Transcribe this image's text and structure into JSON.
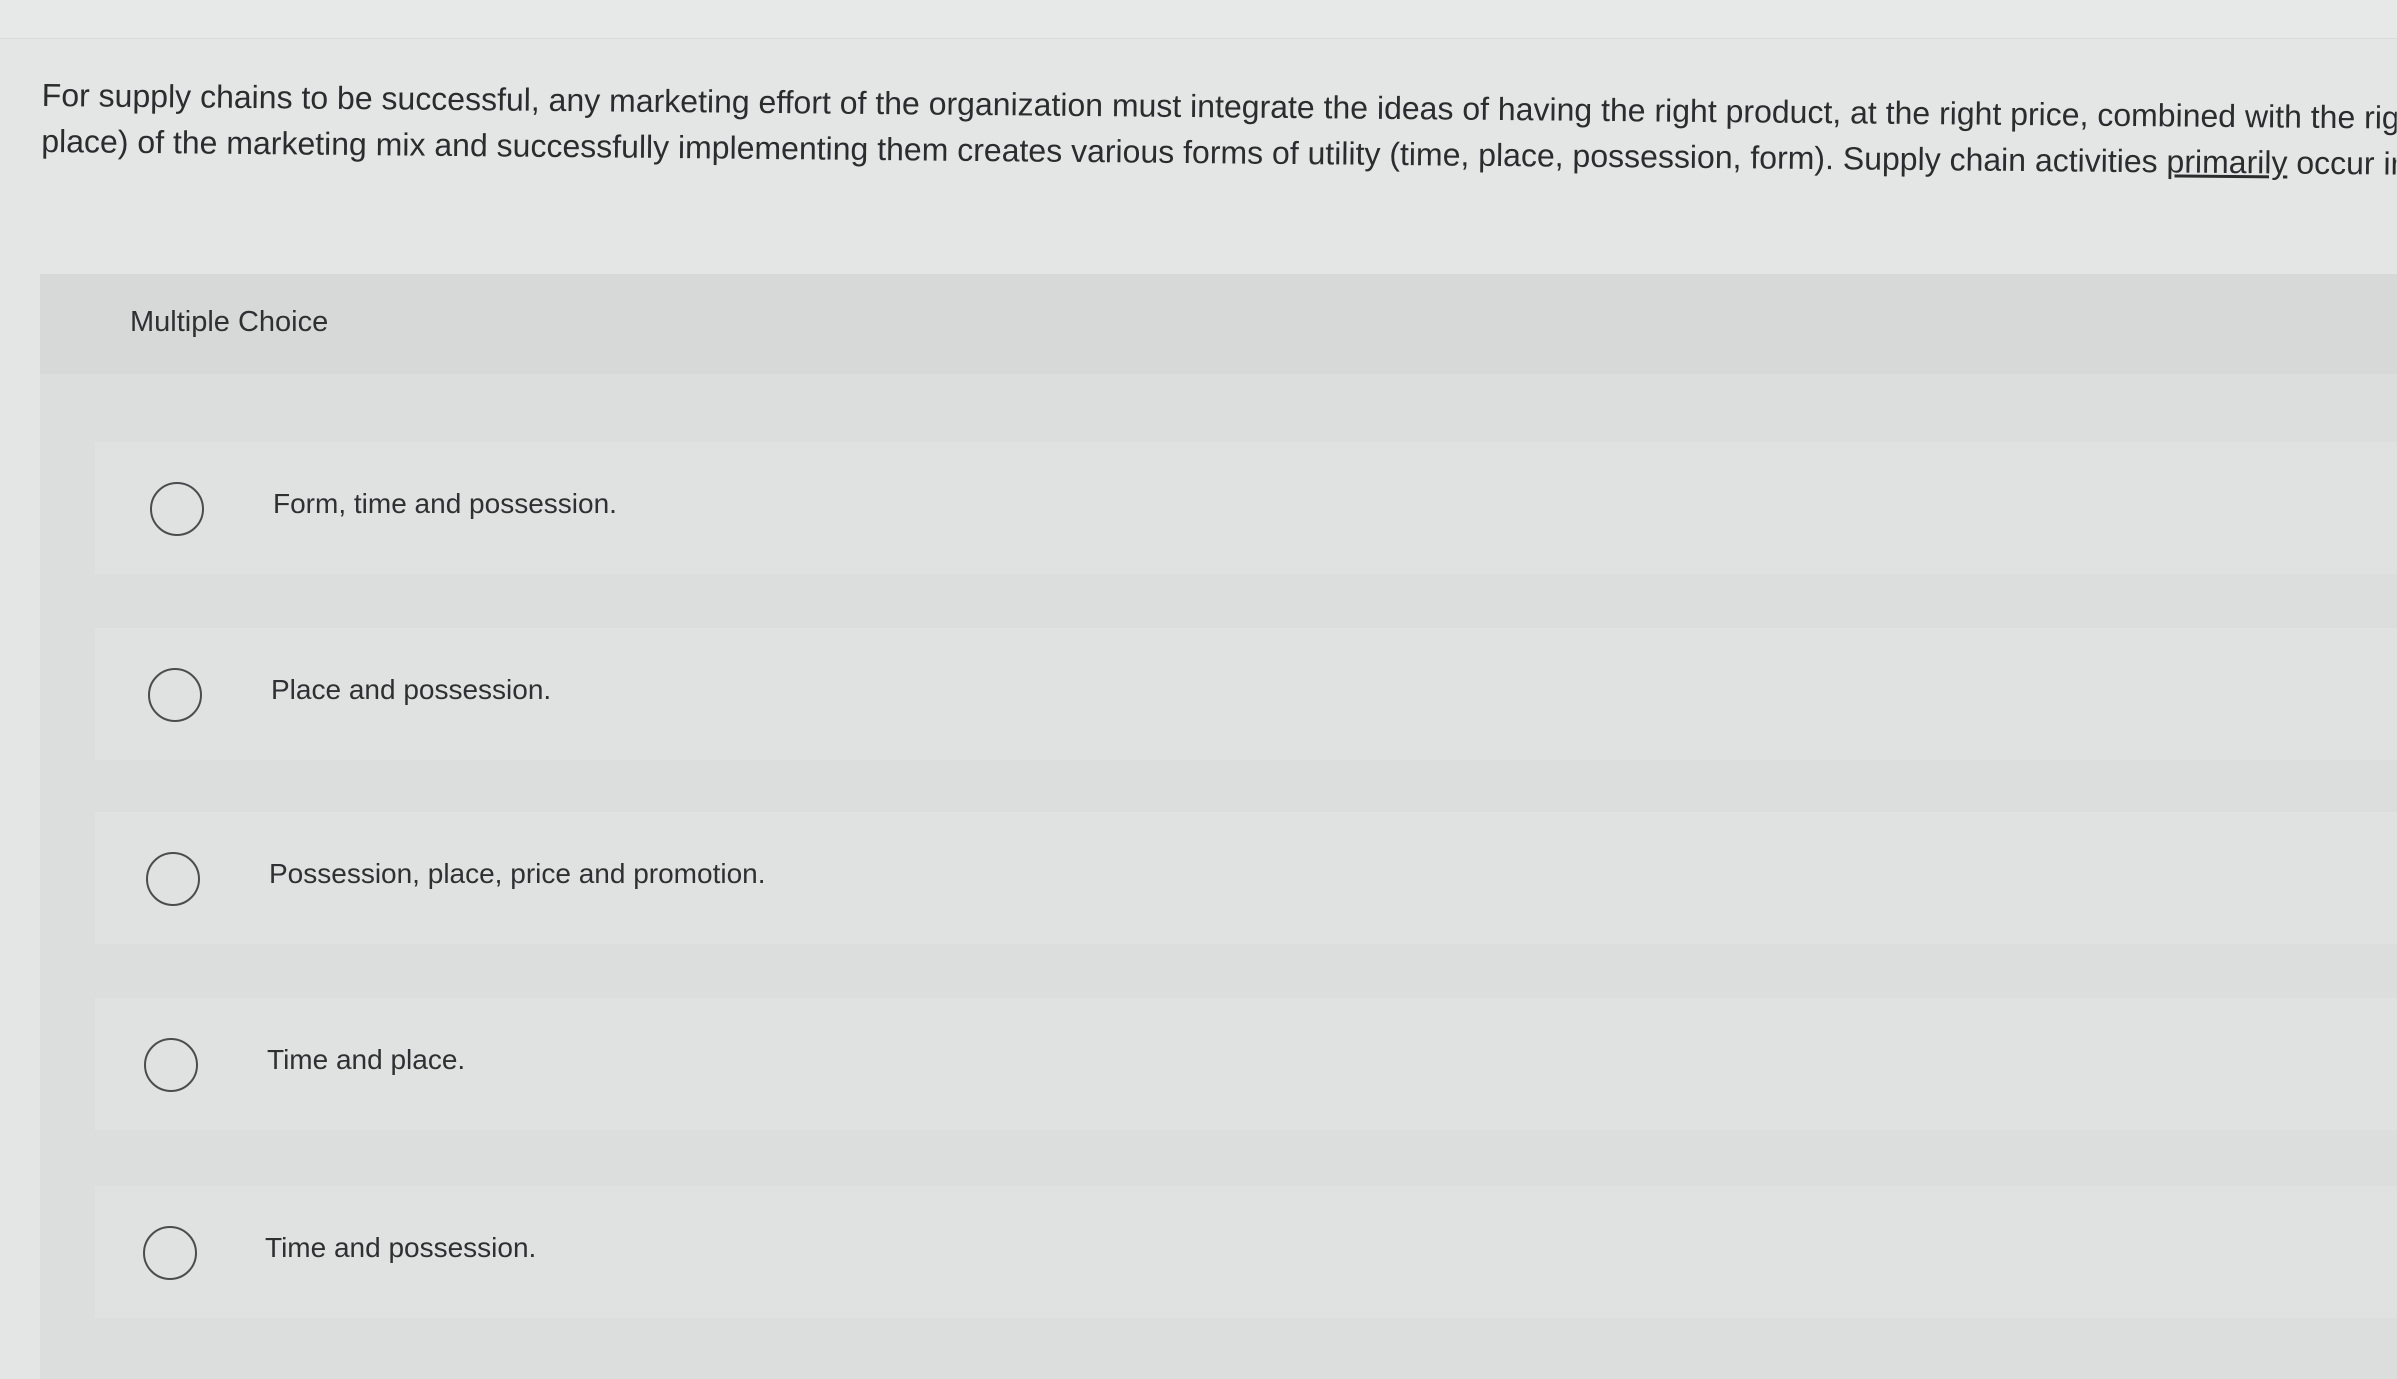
{
  "question": {
    "line1": "For supply chains to be successful, any marketing effort of the organization must integrate the ideas of having the right product, at the right price, combined with the rig",
    "line2_before": "place) of the marketing mix and successfully implementing them creates various forms of utility (time, place, possession, form). Supply chain activities ",
    "line2_underlined": "primarily",
    "line2_after": " occur in r"
  },
  "multiple_choice": {
    "title": "Multiple Choice",
    "options": [
      {
        "label": "Form, time and possession."
      },
      {
        "label": "Place and possession."
      },
      {
        "label": "Possession, place, price and promotion."
      },
      {
        "label": "Time and place."
      },
      {
        "label": "Time and possession."
      }
    ]
  }
}
